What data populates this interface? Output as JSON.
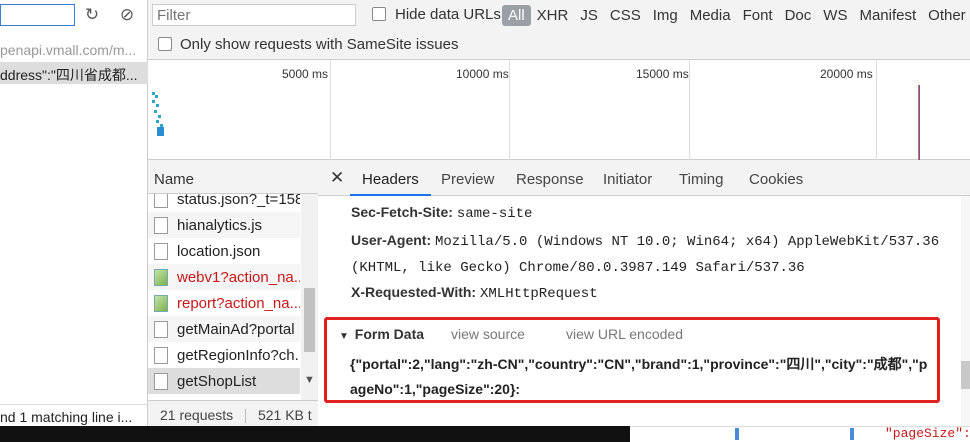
{
  "left_pane": {
    "url_fragment": "penapi.vmall.com/m...",
    "address_fragment": "ddress\":\"四川省成都...",
    "footer_text": "nd 1 matching line i..."
  },
  "toolbar": {
    "filter_placeholder": "Filter",
    "hide_data_urls_label": "Hide data URLs",
    "samesite_label": "Only show requests with SameSite issues",
    "type_filters": [
      "All",
      "XHR",
      "JS",
      "CSS",
      "Img",
      "Media",
      "Font",
      "Doc",
      "WS",
      "Manifest",
      "Other"
    ],
    "active_type": "All"
  },
  "timeline": {
    "ticks": [
      "5000 ms",
      "10000 ms",
      "15000 ms",
      "20000 ms"
    ]
  },
  "name_column": {
    "header": "Name",
    "requests": [
      {
        "name": "status.json?_t=158",
        "color": "#222222",
        "icon": "document-icon"
      },
      {
        "name": "hianalytics.js",
        "color": "#222222",
        "icon": "script-icon"
      },
      {
        "name": "location.json",
        "color": "#222222",
        "icon": "document-icon"
      },
      {
        "name": "webv1?action_na...",
        "color": "#c81818",
        "icon": "image-icon"
      },
      {
        "name": "report?action_na...",
        "color": "#c81818",
        "icon": "image-icon"
      },
      {
        "name": "getMainAd?portal",
        "color": "#222222",
        "icon": "document-icon"
      },
      {
        "name": "getRegionInfo?ch...",
        "color": "#222222",
        "icon": "document-icon"
      },
      {
        "name": "getShopList",
        "color": "#222222",
        "icon": "document-icon"
      }
    ],
    "status_requests": "21 requests",
    "status_size": "521 KB t"
  },
  "detail": {
    "tabs": [
      "Headers",
      "Preview",
      "Response",
      "Initiator",
      "Timing",
      "Cookies"
    ],
    "active_tab": "Headers",
    "headers": [
      {
        "key": "Sec-Fetch-Site:",
        "value": "same-site"
      },
      {
        "key": "User-Agent:",
        "value": "Mozilla/5.0 (Windows NT 10.0; Win64; x64) AppleWebKit/537.36"
      },
      {
        "key": "",
        "value": "(KHTML, like Gecko) Chrome/80.0.3987.149 Safari/537.36"
      },
      {
        "key": "X-Requested-With:",
        "value": "XMLHttpRequest"
      }
    ],
    "form_data": {
      "title": "Form Data",
      "view_source": "view source",
      "view_url_encoded": "view URL encoded",
      "payload": "{\"portal\":2,\"lang\":\"zh-CN\",\"country\":\"CN\",\"brand\":1,\"province\":\"四川\",\"city\":\"成都\",\"pageNo\":1,\"pageSize\":20}:"
    }
  },
  "bottom": {
    "code_fragment": "\"pageSize\":"
  },
  "colors": {
    "highlight_box": "#e02020",
    "error_text": "#c81818",
    "active_tab_underline": "#1a73e8"
  }
}
